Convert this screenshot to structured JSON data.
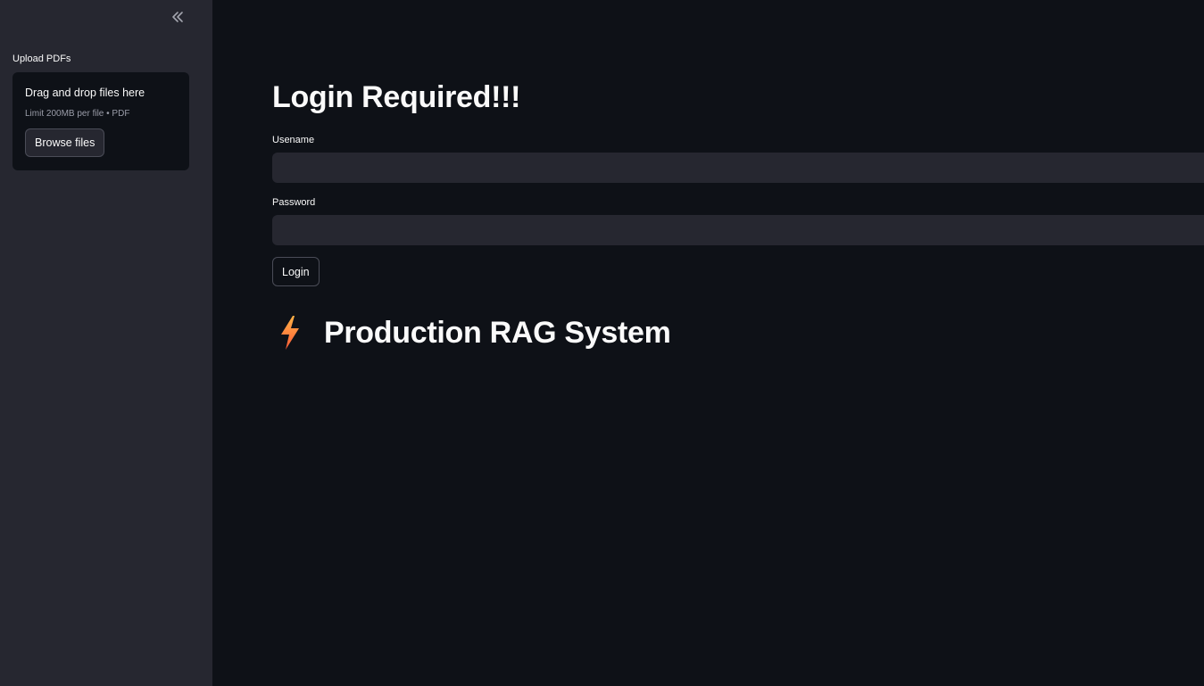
{
  "sidebar": {
    "collapse_icon": "double-chevron-left-icon",
    "upload": {
      "label": "Upload PDFs",
      "drop_title": "Drag and drop files here",
      "drop_limit": "Limit 200MB per file • PDF",
      "browse_label": "Browse files"
    }
  },
  "main": {
    "login_title": "Login Required!!!",
    "username": {
      "label": "Usename",
      "value": ""
    },
    "password": {
      "label": "Password",
      "value": ""
    },
    "login_button": "Login",
    "app_icon": "lightning-bolt-icon",
    "app_title": "Production RAG System"
  },
  "colors": {
    "background": "#0e1117",
    "sidebar": "#262730",
    "input": "#262730",
    "text": "#fafafa",
    "muted": "#9a9ca8",
    "bolt_top": "#ffb347",
    "bolt_bottom": "#ff5a36"
  }
}
